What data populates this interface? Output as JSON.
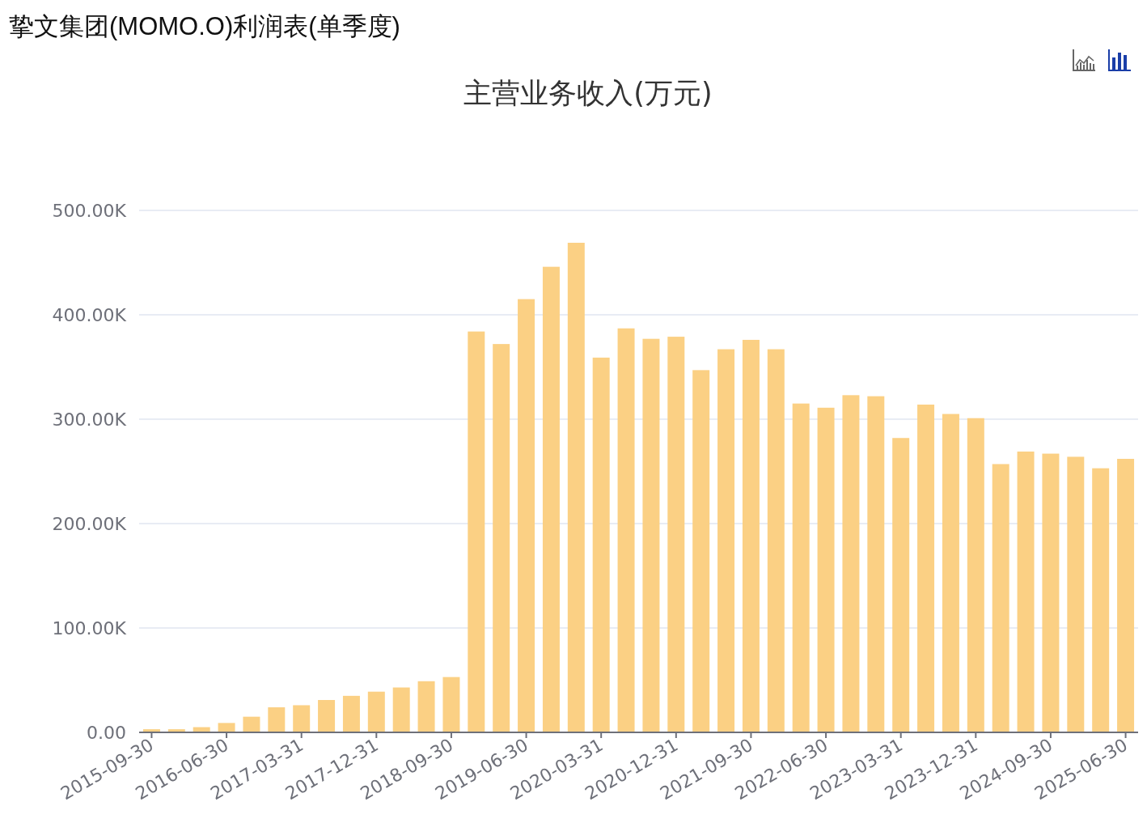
{
  "page_title": "挚文集团(MOMO.O)利润表(单季度)",
  "chart_type_buttons": [
    {
      "kind": "line",
      "selected": false
    },
    {
      "kind": "bar",
      "selected": true
    }
  ],
  "chart": {
    "chart_data": {
      "type": "bar",
      "title": "主营业务收入(万元)",
      "categories": [
        "2015-09-30",
        null,
        null,
        "2016-06-30",
        null,
        null,
        "2017-03-31",
        null,
        null,
        "2017-12-31",
        null,
        null,
        "2018-09-30",
        null,
        null,
        "2019-06-30",
        null,
        null,
        "2020-03-31",
        null,
        null,
        "2020-12-31",
        null,
        null,
        "2021-09-30",
        null,
        null,
        "2022-06-30",
        null,
        null,
        "2023-03-31",
        null,
        null,
        "2023-12-31",
        null,
        null,
        "2024-09-30",
        null,
        null,
        "2025-06-30"
      ],
      "grid": true,
      "series": [
        {
          "color": "#fbd084",
          "values": [
            3,
            3,
            5,
            9,
            15,
            24,
            26,
            31,
            35,
            39,
            43,
            49,
            53,
            384,
            372,
            415,
            446,
            469,
            359,
            387,
            377,
            379,
            347,
            367,
            376,
            367,
            315,
            311,
            323,
            322,
            282,
            314,
            305,
            301,
            257,
            269,
            267,
            264,
            253,
            262
          ]
        }
      ],
      "ylim": [
        0,
        500
      ],
      "yticks": [
        {
          "value": 0,
          "label": "0.00"
        },
        {
          "value": 100,
          "label": "100.00K"
        },
        {
          "value": 200,
          "label": "200.00K"
        },
        {
          "value": 300,
          "label": "300.00K"
        },
        {
          "value": 400,
          "label": "400.00K"
        },
        {
          "value": 500,
          "label": "500.00K"
        }
      ]
    }
  }
}
